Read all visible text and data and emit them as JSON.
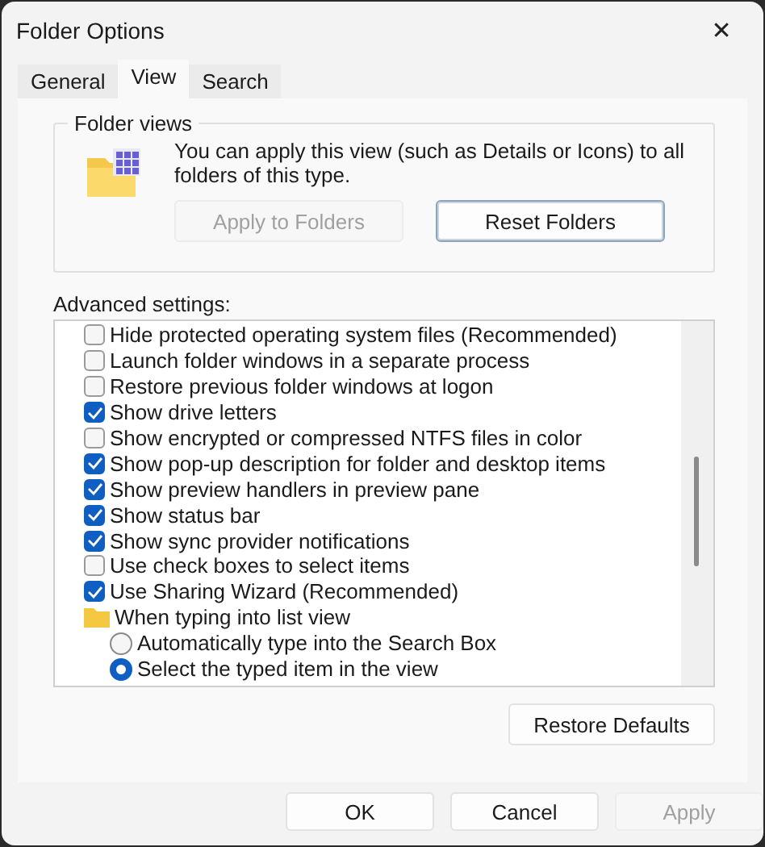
{
  "window": {
    "title": "Folder Options",
    "close": "✕"
  },
  "tabs": [
    {
      "label": "General",
      "selected": false
    },
    {
      "label": "View",
      "selected": true
    },
    {
      "label": "Search",
      "selected": false
    }
  ],
  "folder_views": {
    "title": "Folder views",
    "description": "You can apply this view (such as Details or Icons) to all folders of this type.",
    "buttons": [
      {
        "label": "Apply to Folders",
        "disabled": true,
        "focused": false
      },
      {
        "label": "Reset Folders",
        "disabled": false,
        "focused": true
      }
    ]
  },
  "advanced": {
    "label": "Advanced settings:",
    "items": [
      {
        "kind": "checkbox",
        "label": "Hide protected operating system files (Recommended)",
        "checked": false
      },
      {
        "kind": "checkbox",
        "label": "Launch folder windows in a separate process",
        "checked": false
      },
      {
        "kind": "checkbox",
        "label": "Restore previous folder windows at logon",
        "checked": false
      },
      {
        "kind": "checkbox",
        "label": "Show drive letters",
        "checked": true
      },
      {
        "kind": "checkbox",
        "label": "Show encrypted or compressed NTFS files in color",
        "checked": false
      },
      {
        "kind": "checkbox",
        "label": "Show pop-up description for folder and desktop items",
        "checked": true
      },
      {
        "kind": "checkbox",
        "label": "Show preview handlers in preview pane",
        "checked": true
      },
      {
        "kind": "checkbox",
        "label": "Show status bar",
        "checked": true
      },
      {
        "kind": "checkbox",
        "label": "Show sync provider notifications",
        "checked": true
      },
      {
        "kind": "checkbox",
        "label": "Use check boxes to select items",
        "checked": false
      },
      {
        "kind": "checkbox",
        "label": "Use Sharing Wizard (Recommended)",
        "checked": true
      },
      {
        "kind": "folder",
        "label": "When typing into list view",
        "children": [
          {
            "kind": "radio",
            "label": "Automatically type into the Search Box",
            "selected": false
          },
          {
            "kind": "radio",
            "label": "Select the typed item in the view",
            "selected": true
          }
        ]
      }
    ]
  },
  "restore_button": {
    "label": "Restore Defaults"
  },
  "footer_buttons": [
    {
      "label": "OK",
      "disabled": false
    },
    {
      "label": "Cancel",
      "disabled": false
    },
    {
      "label": "Apply",
      "disabled": true
    }
  ]
}
